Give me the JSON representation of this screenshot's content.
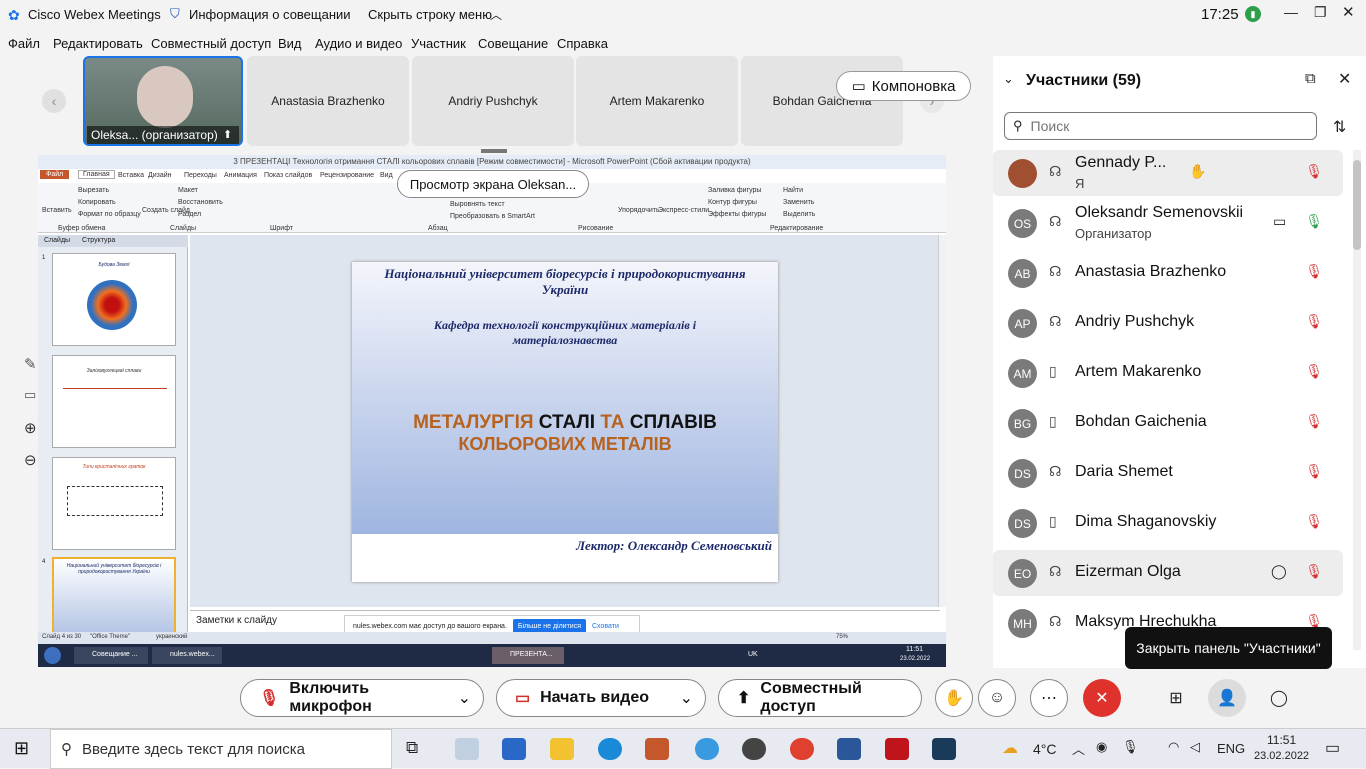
{
  "titlebar": {
    "app": "Cisco Webex Meetings",
    "meeting_info": "Информация о совещании",
    "hide_menu": "Скрыть строку меню",
    "time": "17:25"
  },
  "menu": [
    "Файл",
    "Редактировать",
    "Совместный доступ",
    "Вид",
    "Аудио и видео",
    "Участник",
    "Совещание",
    "Справка"
  ],
  "video_strip": {
    "self_label": "Oleksa... (организатор)",
    "tiles": [
      "Anastasia Brazhenko",
      "Andriy Pushchyk",
      "Artem Makarenko",
      "Bohdan Gaichenia"
    ],
    "layout_button": "Компоновка"
  },
  "share": {
    "view_label": "Просмотр экрана Oleksan...",
    "ppt_title": "3 ПРЕЗЕНТАЦІ Технологія отримання СТАЛІ кольорових сплавів [Режим совместимости] - Microsoft PowerPoint (Сбой активации продукта)",
    "ribbon_tabs": [
      "Файл",
      "Главная",
      "Вставка",
      "Дизайн",
      "Переходы",
      "Анимация",
      "Показ слайдов",
      "Рецензирование",
      "Вид"
    ],
    "ribbon": {
      "paste": "Вставить",
      "cut": "Вырезать",
      "copy": "Копировать",
      "format_painter": "Формат по образцу",
      "clipboard": "Буфер обмена",
      "new_slide": "Создать слайд",
      "layout": "Макет",
      "reset": "Восстановить",
      "section": "Раздел",
      "slides": "Слайды",
      "font": "Шрифт",
      "paragraph": "Абзац",
      "align_text": "Выровнять текст",
      "smartart": "Преобразовать в SmartArt",
      "drawing": "Рисование",
      "arrange": "Упорядочить",
      "express_styles": "Экспресс-стили",
      "shape_fill": "Заливка фигуры",
      "shape_outline": "Контур фигуры",
      "shape_effects": "Эффекты фигуры",
      "find": "Найти",
      "replace": "Заменить",
      "select": "Выделить",
      "editing": "Редактирование"
    },
    "panel_tabs": [
      "Слайды",
      "Структура"
    ],
    "thumbs": [
      {
        "num": "1",
        "title": "Будова Землі"
      },
      {
        "num": "",
        "title": "Залізовуглецеві сплави"
      },
      {
        "num": "",
        "title": "Типи кристалічних граток"
      },
      {
        "num": "4",
        "title": "Національний університет біоресурсів і природокористування України"
      }
    ],
    "slide": {
      "university": "Національний університет біоресурсів і природокористування України",
      "department": "Кафедра технології конструкційних матеріалів і матеріалознавства",
      "title_part1": "МЕТАЛУРГІЯ",
      "title_part2": "СТАЛІ",
      "title_part3": "ТА",
      "title_part4": "СПЛАВІВ",
      "title_line2": "КОЛЬОРОВИХ МЕТАЛІВ",
      "lecturer": "Лектор: Олександр Семеновський"
    },
    "notes": "Заметки к слайду",
    "status": {
      "slide": "Слайд 4 из 30",
      "theme": "\"Office Theme\"",
      "lang": "украинский",
      "zoom": "75%"
    },
    "toast": {
      "text": "nules.webex.com має доступ до вашого екрана.",
      "stop": "Більше не ділитися",
      "hide": "Сховати"
    },
    "inner_taskbar": {
      "item1": "Совещание ...",
      "item2": "nules.webex...",
      "item3": "ПРЕЗЕНТА...",
      "lang": "UK",
      "time": "11:51",
      "date": "23.02.2022"
    }
  },
  "participants": {
    "title": "Участники (59)",
    "search_placeholder": "Поиск",
    "close_tooltip": "Закрыть панель \"Участники\"",
    "list": [
      {
        "initials": "",
        "name": "Gennady P...",
        "role": "Я"
      },
      {
        "initials": "OS",
        "name": "Oleksandr Semenovskii",
        "role": "Организатор"
      },
      {
        "initials": "AB",
        "name": "Anastasia Brazhenko",
        "role": ""
      },
      {
        "initials": "AP",
        "name": "Andriy Pushchyk",
        "role": ""
      },
      {
        "initials": "AM",
        "name": "Artem Makarenko",
        "role": ""
      },
      {
        "initials": "BG",
        "name": "Bohdan Gaichenia",
        "role": ""
      },
      {
        "initials": "DS",
        "name": "Daria Shemet",
        "role": ""
      },
      {
        "initials": "DS",
        "name": "Dima Shaganovskiy",
        "role": ""
      },
      {
        "initials": "EO",
        "name": "Eizerman Olga",
        "role": ""
      },
      {
        "initials": "MH",
        "name": "Maksym Hrechukha",
        "role": ""
      }
    ]
  },
  "controls": {
    "mic": "Включить микрофон",
    "video": "Начать видео",
    "share": "Совместный доступ"
  },
  "windows_taskbar": {
    "search": "Введите здесь текст для поиска",
    "temp": "4°C",
    "lang": "ENG",
    "time": "11:51",
    "date": "23.02.2022"
  },
  "colors": {
    "accent": "#1a73e8",
    "end_call": "#e0322c",
    "slide_orange": "#b8621f"
  }
}
